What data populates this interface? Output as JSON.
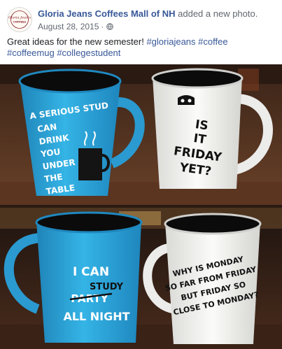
{
  "post": {
    "author": "Gloria Jeans Coffees Mall of NH",
    "action": "added a new photo.",
    "date": "August 28, 2015",
    "separator": "·",
    "visibility_icon": "globe-icon",
    "caption_text": "Great ideas for the new semester!",
    "hashtags": [
      "#gloriajeans",
      "#coffee",
      "#coffeemug",
      "#collegestudent"
    ],
    "avatar_logo_text": [
      "Gloria Jean's",
      "COFFEES"
    ]
  },
  "photo": {
    "mugs": {
      "mug1_lines": [
        "A SERIOUS STUD",
        "CAN",
        "DRINK",
        "YOU",
        "UNDER",
        "THE",
        "TABLE"
      ],
      "mug2_lines": [
        "IS",
        "IT",
        "FRIDAY",
        "YET?"
      ],
      "mug3_lines": [
        "I CAN",
        "STUDY",
        "PARTY",
        "ALL NIGHT"
      ],
      "mug4_lines": [
        "WHY IS MONDAY",
        "SO FAR FROM FRIDAY",
        "BUT FRIDAY SO",
        "CLOSE TO MONDAY?"
      ]
    },
    "colors": {
      "mug_blue": "#29a6db",
      "mug_white": "#f4f4f2",
      "link_blue": "#385898"
    }
  }
}
